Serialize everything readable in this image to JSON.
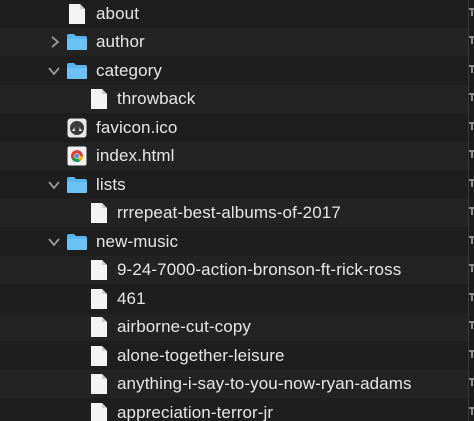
{
  "tree": {
    "items": [
      {
        "label": "about",
        "icon": "file-icon",
        "chevron": ""
      },
      {
        "label": "author",
        "icon": "folder-icon",
        "chevron": "collapsed"
      },
      {
        "label": "category",
        "icon": "folder-icon",
        "chevron": "expanded"
      },
      {
        "label": "throwback",
        "icon": "file-icon",
        "chevron": ""
      },
      {
        "label": "favicon.ico",
        "icon": "image-icon",
        "chevron": ""
      },
      {
        "label": "index.html",
        "icon": "chrome-icon",
        "chevron": ""
      },
      {
        "label": "lists",
        "icon": "folder-icon",
        "chevron": "expanded"
      },
      {
        "label": "rrrepeat-best-albums-of-2017",
        "icon": "file-icon",
        "chevron": ""
      },
      {
        "label": "new-music",
        "icon": "folder-icon",
        "chevron": "expanded"
      },
      {
        "label": "9-24-7000-action-bronson-ft-rick-ross",
        "icon": "file-icon",
        "chevron": ""
      },
      {
        "label": "461",
        "icon": "file-icon",
        "chevron": ""
      },
      {
        "label": "airborne-cut-copy",
        "icon": "file-icon",
        "chevron": ""
      },
      {
        "label": "alone-together-leisure",
        "icon": "file-icon",
        "chevron": ""
      },
      {
        "label": "anything-i-say-to-you-now-ryan-adams",
        "icon": "file-icon",
        "chevron": ""
      },
      {
        "label": "appreciation-terror-jr",
        "icon": "file-icon",
        "chevron": ""
      }
    ]
  },
  "colors": {
    "background": "#1e1e1e",
    "alt_row": "#232323",
    "text": "#e6e6e6",
    "folder": "#5ab4ef",
    "chevron": "#9a9a9a"
  }
}
